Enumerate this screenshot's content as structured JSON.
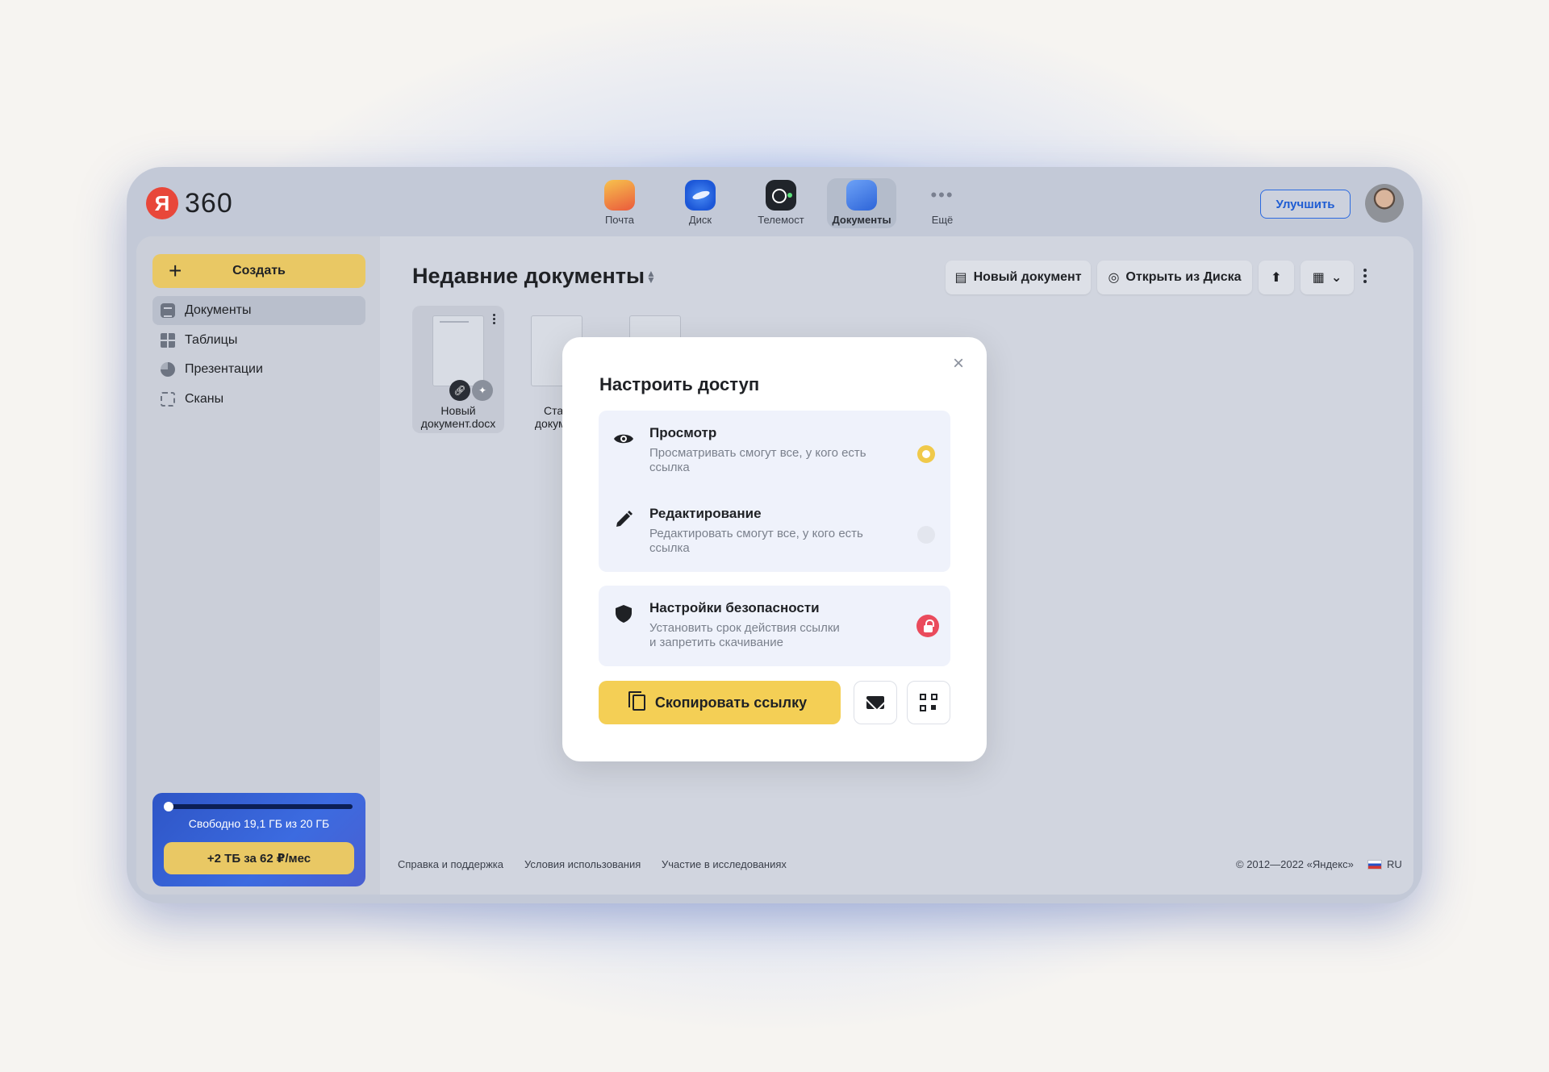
{
  "header": {
    "logo_mark": "Я",
    "logo_text": "360",
    "apps": [
      {
        "label": "Почта",
        "icon": "mail-icon"
      },
      {
        "label": "Диск",
        "icon": "disk-icon"
      },
      {
        "label": "Телемост",
        "icon": "telemost-icon"
      },
      {
        "label": "Документы",
        "icon": "documents-icon",
        "active": true
      },
      {
        "label": "Ещё",
        "icon": "more-icon"
      }
    ],
    "upgrade_label": "Улучшить"
  },
  "sidebar": {
    "create_label": "Создать",
    "items": [
      {
        "label": "Документы",
        "icon": "document-icon",
        "active": true
      },
      {
        "label": "Таблицы",
        "icon": "table-icon"
      },
      {
        "label": "Презентации",
        "icon": "presentation-icon"
      },
      {
        "label": "Сканы",
        "icon": "scan-icon"
      }
    ],
    "storage": {
      "text": "Свободно 19,1 ГБ из 20 ГБ",
      "used_fraction": 0.045,
      "offer_label": "+2 ТБ  за 62 ₽/мес"
    }
  },
  "main": {
    "title": "Недавние документы",
    "toolbar": {
      "new_doc_label": "Новый документ",
      "open_disk_label": "Открыть из Диска"
    },
    "files": [
      {
        "name_line1": "Новый",
        "name_line2": "документ.docx",
        "selected": true
      },
      {
        "name_line1": "Стар",
        "name_line2": "докумен"
      }
    ]
  },
  "footer": {
    "links": [
      "Справка и поддержка",
      "Условия использования",
      "Участие в исследованиях"
    ],
    "copyright": "© 2012—2022 «Яндекс»",
    "lang": "RU"
  },
  "modal": {
    "title": "Настроить доступ",
    "options": [
      {
        "title": "Просмотр",
        "desc": "Просматривать смогут все, у кого есть ссылка",
        "icon": "eye-icon",
        "selected": true
      },
      {
        "title": "Редактирование",
        "desc": "Редактировать смогут все, у кого есть ссылка",
        "icon": "pencil-icon",
        "selected": false
      }
    ],
    "security": {
      "title": "Настройки безопасности",
      "desc_line1": "Установить срок действия ссылки",
      "desc_line2": "и запретить скачивание",
      "icon": "shield-icon"
    },
    "copy_label": "Скопировать ссылку",
    "colors": {
      "accent": "#f4cf55",
      "lock": "#ea4b5c"
    }
  }
}
